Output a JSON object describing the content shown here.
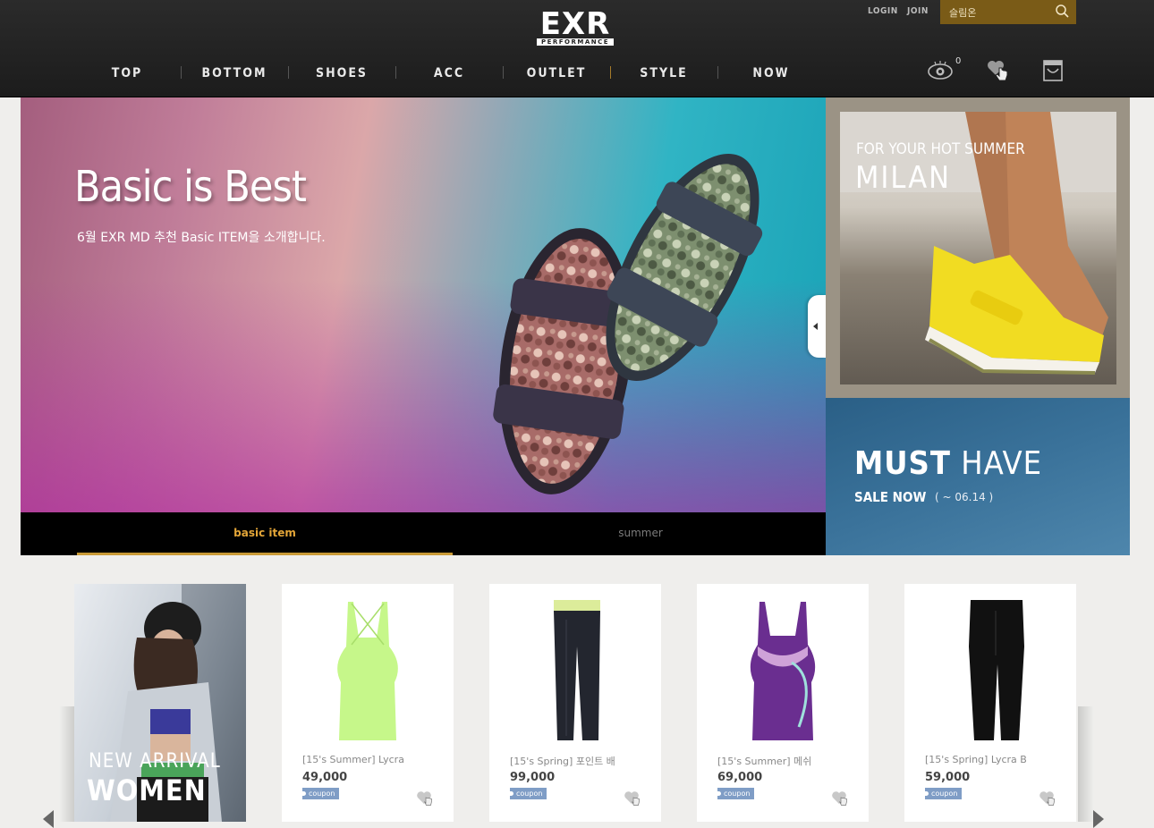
{
  "header": {
    "logo_text": "EXR",
    "logo_sub": "PERFORMANCE",
    "login": "LOGIN",
    "join": "JOIN",
    "search_placeholder": "슬림온",
    "view_count": "0",
    "nav": [
      "TOP",
      "BOTTOM",
      "SHOES",
      "ACC",
      "OUTLET",
      "STYLE",
      "NOW"
    ]
  },
  "hero": {
    "title": "Basic is Best",
    "subtitle": "6월 EXR MD 추천 Basic ITEM을 소개합니다.",
    "tabs": [
      {
        "label": "basic item",
        "active": true
      },
      {
        "label": "summer",
        "active": false
      }
    ]
  },
  "banners": {
    "milan": {
      "kicker": "FOR YOUR HOT SUMMER",
      "title": "MILAN"
    },
    "must_have": {
      "title_bold": "MUST",
      "title_rest": "HAVE",
      "sale": "SALE NOW",
      "date": "( ~ 06.14 )"
    }
  },
  "new_arrival": {
    "line1": "NEW ARRIVAL",
    "line2": "WOMEN"
  },
  "products": [
    {
      "name": "[15's Summer] Lycra",
      "price": "49,000",
      "coupon": "coupon"
    },
    {
      "name": "[15's Spring] 포인트 배",
      "price": "99,000",
      "coupon": "coupon"
    },
    {
      "name": "[15's Summer] 메쉬",
      "price": "69,000",
      "coupon": "coupon"
    },
    {
      "name": "[15's Spring] Lycra B",
      "price": "59,000",
      "coupon": "coupon"
    }
  ],
  "colors": {
    "header_bg": "#222222",
    "accent_gold": "#c99a36",
    "search_bg": "#7a5b17",
    "must_have_bg": "#3a729a",
    "coupon_bg": "#7f9dc6"
  }
}
